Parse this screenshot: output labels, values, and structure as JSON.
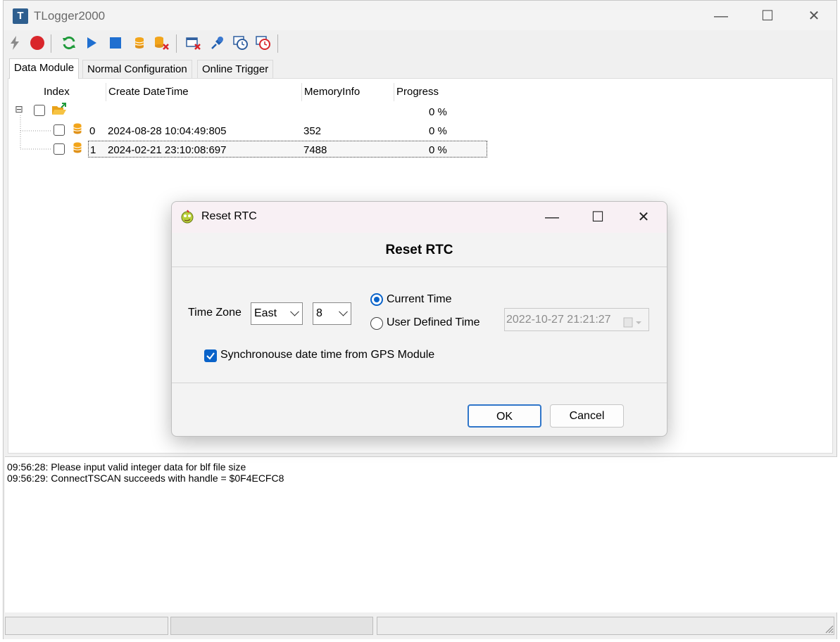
{
  "window": {
    "title": "TLogger2000",
    "app_icon_letter": "T"
  },
  "window_controls": {
    "minimize": "—",
    "maximize": "☐",
    "close": "✕"
  },
  "toolbar": {
    "icons": [
      "connect-icon",
      "record-icon",
      "refresh-icon",
      "play-icon",
      "stop-icon",
      "database-icon",
      "delete-database-icon",
      "clear-window-icon",
      "pin-icon",
      "clock-icon",
      "clock-delete-icon"
    ]
  },
  "tabs": [
    {
      "label": "Data Module",
      "active": true
    },
    {
      "label": "Normal Configuration",
      "active": false
    },
    {
      "label": "Online Trigger",
      "active": false
    }
  ],
  "table": {
    "columns": [
      "Index",
      "Create DateTime",
      "MemoryInfo",
      "Progress"
    ],
    "root": {
      "expander": "⊟",
      "progress": "0 %"
    },
    "rows": [
      {
        "index": "0",
        "datetime": "2024-08-28 10:04:49:805",
        "memory": "352",
        "progress": "0 %"
      },
      {
        "index": "1",
        "datetime": "2024-02-21 23:10:08:697",
        "memory": "7488",
        "progress": "0 %"
      }
    ]
  },
  "log": {
    "lines": [
      "09:56:28: Please input valid integer data for blf file size",
      "09:56:29: ConnectTSCAN succeeds with handle = $0F4ECFC8"
    ]
  },
  "dialog": {
    "title": "Reset RTC",
    "heading": "Reset RTC",
    "time_zone_label": "Time Zone",
    "direction_value": "East",
    "offset_value": "8",
    "radio_current": "Current Time",
    "radio_user": "User Defined Time",
    "selected_radio": "Current Time",
    "datetime_value": "2022-10-27 21:21:27",
    "gps_checkbox_label": "Synchronouse date time from GPS Module",
    "gps_checked": true,
    "ok_label": "OK",
    "cancel_label": "Cancel",
    "controls": {
      "minimize": "—",
      "maximize": "☐",
      "close": "✕"
    }
  },
  "colors": {
    "accent": "#0a63c9",
    "record": "#d9262b",
    "refresh": "#1f9a3a",
    "play_stop": "#1f6fd0",
    "database": "#f2a51b"
  }
}
